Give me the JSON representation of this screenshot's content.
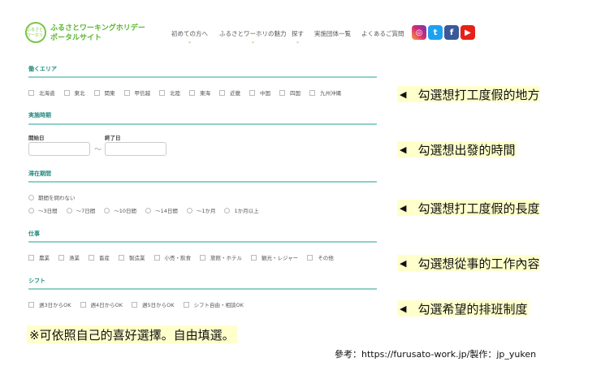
{
  "header": {
    "logo_text": "ふるさとワーホリ",
    "site_title_line1": "ふるさとワーキングホリデー",
    "site_title_line2": "ポータルサイト",
    "nav": [
      {
        "label": "初めての方へ",
        "has_dropdown": true
      },
      {
        "label": "ふるさとワーホリの魅力",
        "has_dropdown": true
      },
      {
        "label": "探す",
        "has_dropdown": true
      },
      {
        "label": "実施団体一覧",
        "has_dropdown": false
      },
      {
        "label": "よくあるご質問",
        "has_dropdown": false
      }
    ],
    "chevron": "⌄",
    "social": [
      {
        "name": "instagram-icon",
        "glyph": "◎",
        "color": "#c13584"
      },
      {
        "name": "twitter-icon",
        "glyph": "t",
        "color": "#1da1f2"
      },
      {
        "name": "facebook-icon",
        "glyph": "f",
        "color": "#3b5998"
      },
      {
        "name": "youtube-icon",
        "glyph": "▶",
        "color": "#e62117"
      }
    ]
  },
  "form": {
    "area": {
      "title": "働くエリア",
      "options": [
        "北海道",
        "東北",
        "関東",
        "甲信越",
        "北陸",
        "東海",
        "近畿",
        "中国",
        "四国",
        "九州沖縄"
      ]
    },
    "period": {
      "title": "実施時期",
      "start_label": "開始日",
      "end_label": "終了日",
      "separator": "～",
      "start_value": "",
      "end_value": ""
    },
    "stay": {
      "title": "滞在期間",
      "any": "期間を問わない",
      "options": [
        "～3日間",
        "～7日間",
        "～10日間",
        "～14日間",
        "～1か月",
        "1か月以上"
      ]
    },
    "job": {
      "title": "仕事",
      "options": [
        "農業",
        "漁業",
        "畜産",
        "製造業",
        "小売・飲食",
        "旅館・ホテル",
        "観光・レジャー",
        "その他"
      ]
    },
    "shift": {
      "title": "シフト",
      "options": [
        "週3日からOK",
        "週4日からOK",
        "週5日からOK",
        "シフト自由・相談OK"
      ]
    }
  },
  "annotations": {
    "marker": "◀",
    "items": [
      "勾選想打工度假的地方",
      "勾選想出發的時間",
      "勾選想打工度假的長度",
      "勾選想從事的工作內容",
      "勾選希望的排班制度"
    ]
  },
  "note": "※可依照自己的喜好選擇。自由填選。",
  "credit": "參考：https://furusato-work.jp/製作：jp_yuken"
}
